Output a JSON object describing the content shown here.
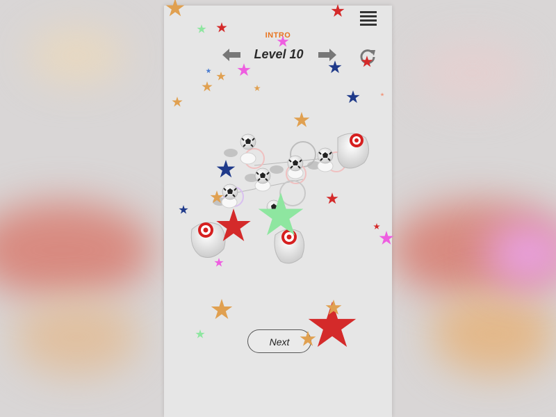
{
  "level": {
    "mode_label": "INTRO",
    "title": "Level 10"
  },
  "icons": {
    "menu": "hamburger-icon",
    "prev": "arrow-left-icon",
    "next": "arrow-right-icon",
    "restart": "restart-icon"
  },
  "buttons": {
    "next_label": "Next"
  },
  "colors": {
    "accent": "#e8731e",
    "star_red": "#d42a2a",
    "star_orange": "#e0a050",
    "star_blue": "#1f3a8a",
    "star_pink": "#ee5ee0",
    "star_green": "#8ee6a0",
    "target_red": "#d61f1f"
  }
}
